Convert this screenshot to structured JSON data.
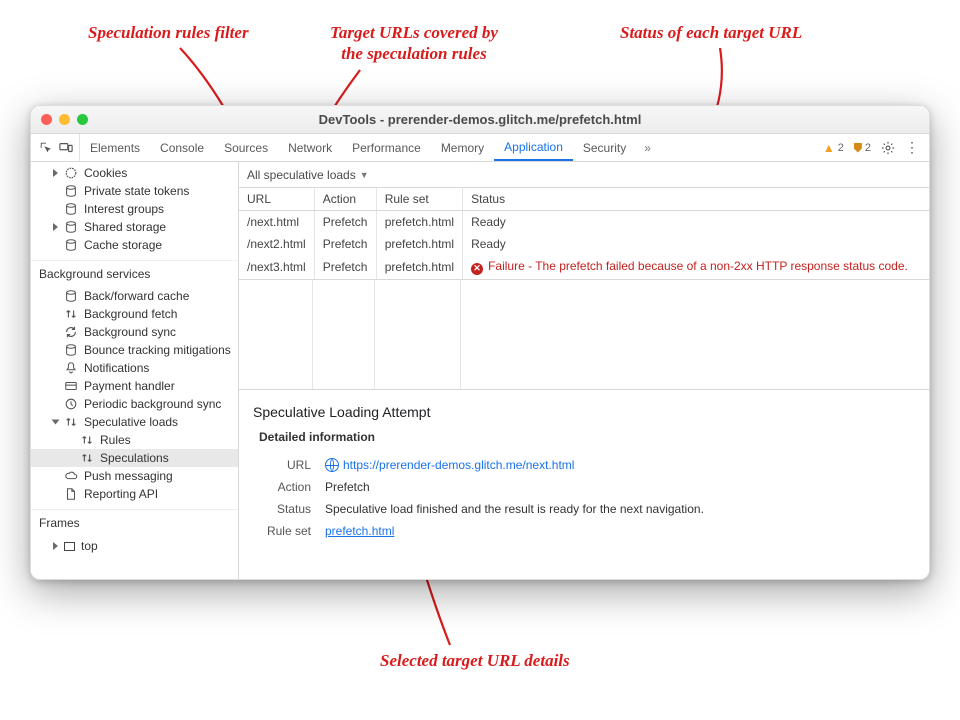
{
  "annotations": {
    "filter": "Speculation rules filter",
    "urls": "Target URLs covered by\nthe speculation rules",
    "status": "Status of each target URL",
    "details": "Selected target URL details"
  },
  "window": {
    "title": "DevTools - prerender-demos.glitch.me/prefetch.html"
  },
  "tabs": {
    "items": [
      "Elements",
      "Console",
      "Sources",
      "Network",
      "Performance",
      "Memory",
      "Application",
      "Security"
    ],
    "active": "Application",
    "warnings": "2",
    "breakpoints": "2"
  },
  "sidebar": {
    "storage": [
      {
        "label": "Cookies",
        "icon": "cookie",
        "hasChildren": true
      },
      {
        "label": "Private state tokens",
        "icon": "db"
      },
      {
        "label": "Interest groups",
        "icon": "db"
      },
      {
        "label": "Shared storage",
        "icon": "db",
        "hasChildren": true
      },
      {
        "label": "Cache storage",
        "icon": "db"
      }
    ],
    "bg_header": "Background services",
    "bg": [
      {
        "label": "Back/forward cache",
        "icon": "db"
      },
      {
        "label": "Background fetch",
        "icon": "updown"
      },
      {
        "label": "Background sync",
        "icon": "sync"
      },
      {
        "label": "Bounce tracking mitigations",
        "icon": "db"
      },
      {
        "label": "Notifications",
        "icon": "bell"
      },
      {
        "label": "Payment handler",
        "icon": "card"
      },
      {
        "label": "Periodic background sync",
        "icon": "clock"
      },
      {
        "label": "Speculative loads",
        "icon": "updown",
        "hasChildren": true,
        "open": true
      },
      {
        "label": "Rules",
        "icon": "updown",
        "indent": 2
      },
      {
        "label": "Speculations",
        "icon": "updown",
        "indent": 2,
        "selected": true
      },
      {
        "label": "Push messaging",
        "icon": "cloud"
      },
      {
        "label": "Reporting API",
        "icon": "file"
      }
    ],
    "frames_header": "Frames",
    "frame_top": "top"
  },
  "filter": {
    "label": "All speculative loads"
  },
  "table": {
    "headers": [
      "URL",
      "Action",
      "Rule set",
      "Status"
    ],
    "rows": [
      {
        "url": "/next.html",
        "action": "Prefetch",
        "ruleset": "prefetch.html",
        "status": "Ready",
        "error": false
      },
      {
        "url": "/next2.html",
        "action": "Prefetch",
        "ruleset": "prefetch.html",
        "status": "Ready",
        "error": false
      },
      {
        "url": "/next3.html",
        "action": "Prefetch",
        "ruleset": "prefetch.html",
        "status": "Failure - The prefetch failed because of a non-2xx HTTP response status code.",
        "error": true
      }
    ]
  },
  "detail": {
    "heading": "Speculative Loading Attempt",
    "subhead": "Detailed information",
    "url_label": "URL",
    "url_value": "https://prerender-demos.glitch.me/next.html",
    "action_label": "Action",
    "action_value": "Prefetch",
    "status_label": "Status",
    "status_value": "Speculative load finished and the result is ready for the next navigation.",
    "ruleset_label": "Rule set",
    "ruleset_value": "prefetch.html"
  }
}
